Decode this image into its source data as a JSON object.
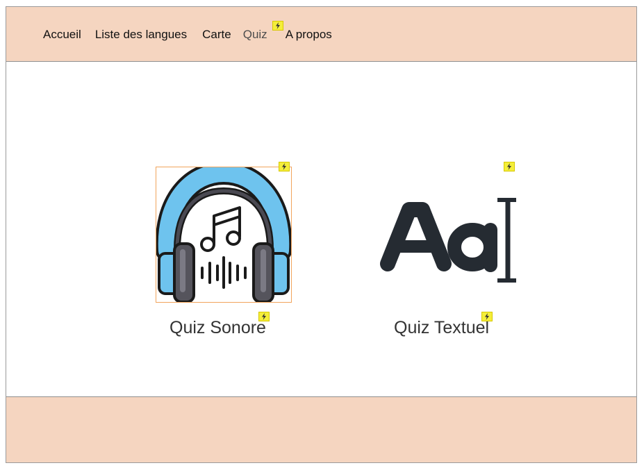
{
  "nav": {
    "items": [
      {
        "label": "Accueil"
      },
      {
        "label": "Liste des langues"
      },
      {
        "label": "Carte"
      },
      {
        "label": "Quiz"
      },
      {
        "label": "A propos"
      }
    ]
  },
  "cards": {
    "sound": {
      "label": "Quiz Sonore",
      "icon": "headphones-music-icon"
    },
    "text": {
      "label": "Quiz Textuel",
      "icon": "text-aa-cursor-icon"
    }
  },
  "colors": {
    "header_bg": "#f5d5c0",
    "footer_bg": "#f5d5c0",
    "bolt_badge": "#f4ee3a",
    "selection_border": "#f2a45b",
    "headphone_blue": "#6ec3ee",
    "text_icon_dark": "#252b32"
  }
}
